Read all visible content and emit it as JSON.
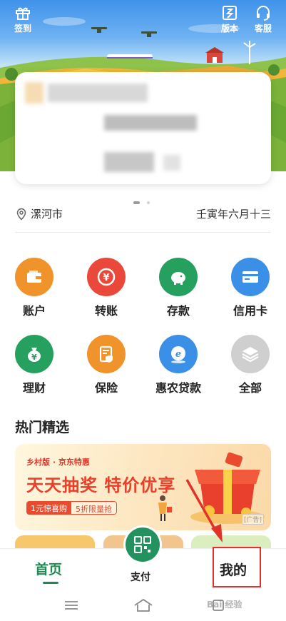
{
  "header": {
    "signin_label": "签到",
    "version_label": "版本",
    "service_label": "客服"
  },
  "location": {
    "city": "漯河市",
    "lunar_date": "壬寅年六月十三"
  },
  "grid": [
    {
      "label": "账户",
      "icon": "wallet-icon",
      "color": "#f0932b"
    },
    {
      "label": "转账",
      "icon": "transfer-icon",
      "color": "#e9483a"
    },
    {
      "label": "存款",
      "icon": "piggy-bank-icon",
      "color": "#25a05e"
    },
    {
      "label": "信用卡",
      "icon": "credit-card-icon",
      "color": "#3a8fe6"
    },
    {
      "label": "理财",
      "icon": "money-bag-icon",
      "color": "#25a05e"
    },
    {
      "label": "保险",
      "icon": "insurance-icon",
      "color": "#f0932b"
    },
    {
      "label": "惠农贷款",
      "icon": "loan-icon",
      "color": "#3a8fe6"
    },
    {
      "label": "全部",
      "icon": "layers-icon",
      "color": "#cfcfcf"
    }
  ],
  "section": {
    "title": "热门精选"
  },
  "ad": {
    "brand": "乡村版 · 京东特惠",
    "slogan": "天天抽奖 特价优享",
    "promo_left": "1元惊喜购",
    "promo_right": "5折限量抢",
    "tag": "广告"
  },
  "bottom_nav": {
    "home": "首页",
    "pay": "支付",
    "mine": "我的"
  },
  "watermark": "Bai 经验",
  "colors": {
    "brand_green": "#1e8a52",
    "annotation_red": "#e0342b"
  }
}
